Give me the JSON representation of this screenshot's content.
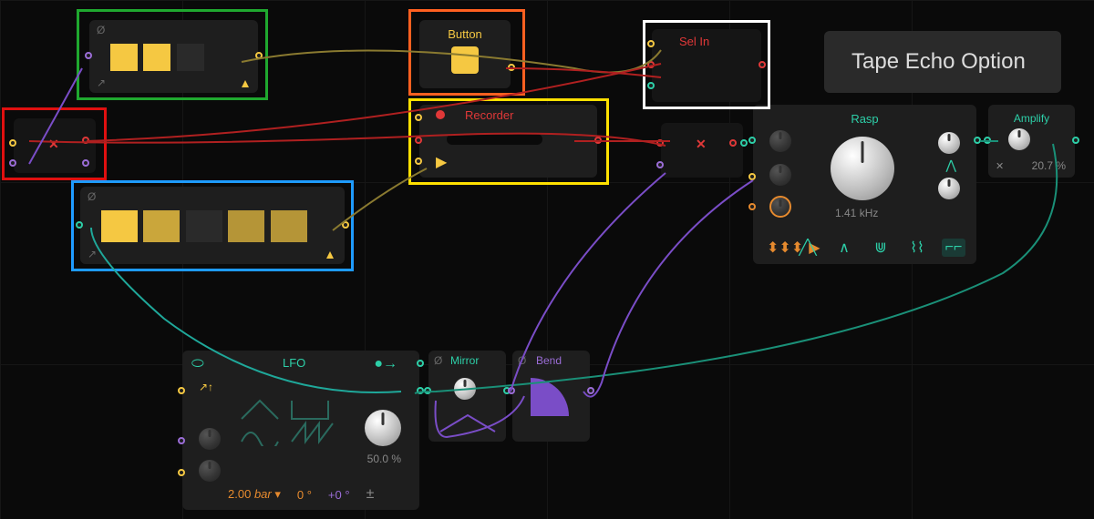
{
  "title_panel": {
    "text": "Tape Echo Option"
  },
  "button_node": {
    "label": "Button"
  },
  "recorder_node": {
    "label": "Recorder"
  },
  "sel_in_node": {
    "label": "Sel In"
  },
  "rasp_node": {
    "label": "Rasp",
    "freq_value": "1.41 kHz"
  },
  "amplify_node": {
    "label": "Amplify",
    "value": "20.7 %"
  },
  "lfo_node": {
    "label": "LFO",
    "amount_value": "50.0 %",
    "rate_value": "2.00",
    "rate_unit": "bar",
    "phase_a": "0 °",
    "phase_b": "+0 °"
  },
  "mirror_node": {
    "label": "Mirror"
  },
  "bend_node": {
    "label": "Bend"
  },
  "seq1": {
    "steps": [
      true,
      true,
      false
    ]
  },
  "seq2": {
    "steps": [
      true,
      true,
      false,
      true,
      true
    ]
  },
  "colors": {
    "yellow": "#f5c842",
    "red": "#e03838",
    "teal": "#2dcfa8",
    "purple": "#9b6dd7",
    "orange": "#e68a2e",
    "green_hl": "#1fa82f",
    "red_hl": "#e01010",
    "orange_hl": "#ff6020",
    "yellow_hl": "#ffe000",
    "blue_hl": "#1e9bff",
    "white_hl": "#ffffff"
  }
}
